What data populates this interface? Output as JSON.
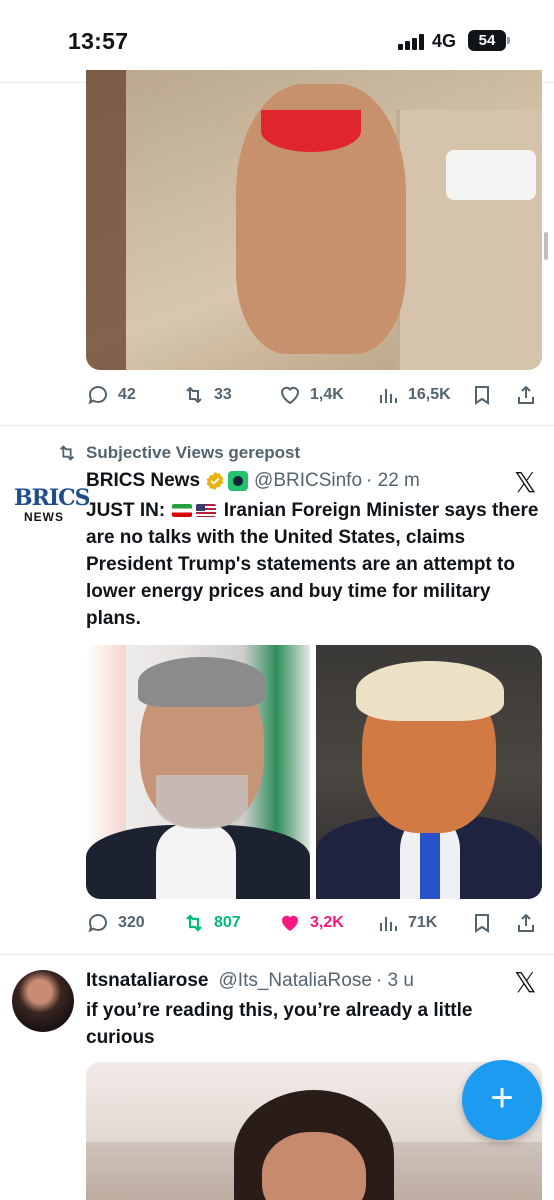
{
  "status_bar": {
    "time": "13:57",
    "network": "4G",
    "battery": "54"
  },
  "tweet1": {
    "actions": {
      "replies": "42",
      "reposts": "33",
      "likes": "1,4K",
      "views": "16,5K"
    }
  },
  "tweet2": {
    "repost_label": "Subjective Views gerepost",
    "avatar": {
      "line1": "BRICS",
      "line2": "NEWS"
    },
    "name": "BRICS News",
    "handle": "@BRICSinfo",
    "time": "· 22 m",
    "text_lead": "JUST IN:",
    "text_rest": "Iranian Foreign Minister says there are no talks with the United States, claims President Trump's statements are an attempt to lower energy prices and buy time for military plans.",
    "actions": {
      "replies": "320",
      "reposts": "807",
      "likes": "3,2K",
      "views": "71K"
    }
  },
  "tweet3": {
    "name": "Itsnataliarose",
    "handle": "@Its_NataliaRose",
    "time": "· 3 u",
    "text": "if you’re reading this, you’re already a little curious"
  },
  "fab": {
    "label": "+"
  },
  "colors": {
    "accent": "#1d9bf0",
    "repost_green": "#00ba7c",
    "like_pink": "#f91880",
    "muted": "#536471"
  }
}
